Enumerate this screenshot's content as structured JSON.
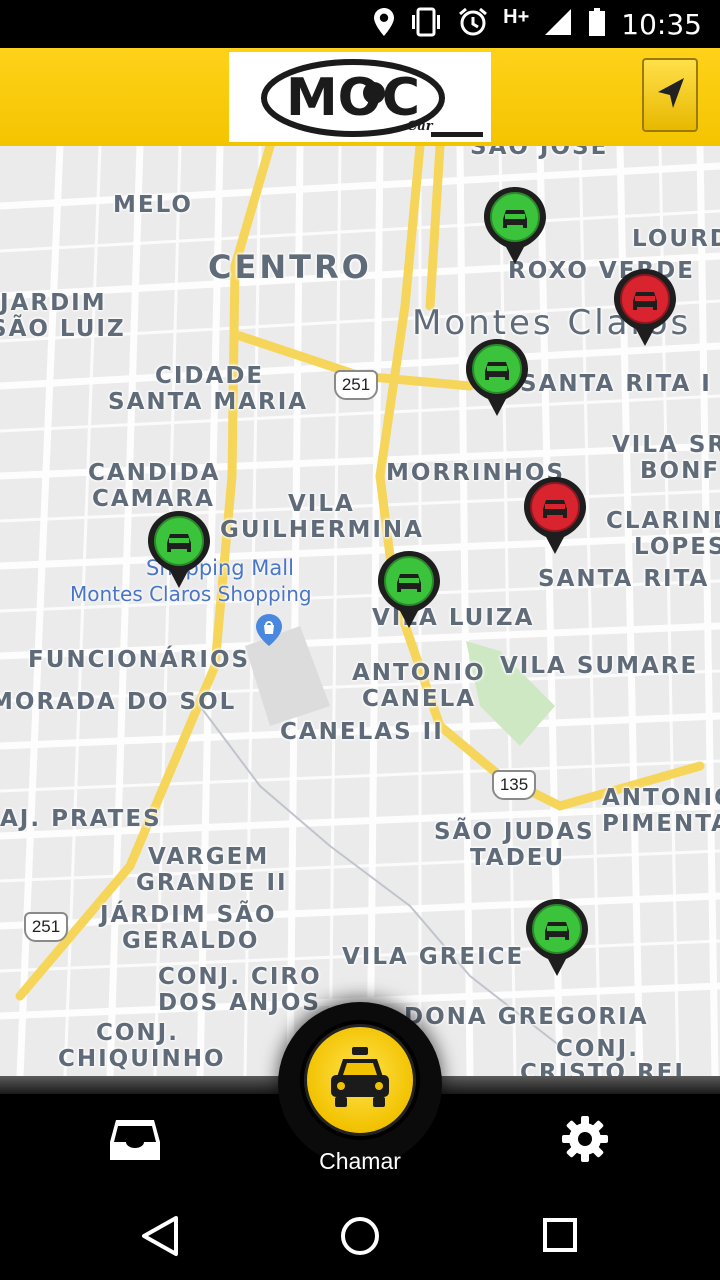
{
  "status_bar": {
    "time": "10:35",
    "network": "H+"
  },
  "app": {
    "logo_text": "MOC",
    "logo_sub": "Car"
  },
  "map": {
    "labels": [
      {
        "text": "SÃO JOSÉ"
      },
      {
        "text": "MELO"
      },
      {
        "text": "CENTRO"
      },
      {
        "text": "LOURD"
      },
      {
        "text": "ROXO VERDE"
      },
      {
        "text": "JARDIM"
      },
      {
        "text": "SÃO LUIZ"
      },
      {
        "text": "Montes Claros"
      },
      {
        "text": "CIDADE"
      },
      {
        "text": "SANTA MARIA"
      },
      {
        "text": "SANTA RITA I"
      },
      {
        "text": "VILA SR"
      },
      {
        "text": "BONF"
      },
      {
        "text": "CANDIDA"
      },
      {
        "text": "CAMARA"
      },
      {
        "text": "MORRINHOS"
      },
      {
        "text": "VILA"
      },
      {
        "text": "GUILHERMINA"
      },
      {
        "text": "CLARIND"
      },
      {
        "text": "LOPES"
      },
      {
        "text": "SANTA RITA"
      },
      {
        "text": "VILA LUIZA"
      },
      {
        "text": "FUNCIONÁRIOS"
      },
      {
        "text": "ANTONIO"
      },
      {
        "text": "CANELA"
      },
      {
        "text": "VILA SUMARE"
      },
      {
        "text": "MORADA DO SOL"
      },
      {
        "text": "CANELAS II"
      },
      {
        "text": "ANTONIO"
      },
      {
        "text": "PIMENTA"
      },
      {
        "text": "AJ. PRATES"
      },
      {
        "text": "SÃO JUDAS"
      },
      {
        "text": "TADEU"
      },
      {
        "text": "VARGEM"
      },
      {
        "text": "GRANDE II"
      },
      {
        "text": "JÁRDIM SÃO"
      },
      {
        "text": "GERALDO"
      },
      {
        "text": "VILA GREICE"
      },
      {
        "text": "CONJ. CIRO"
      },
      {
        "text": "DOS ANJOS"
      },
      {
        "text": "DONA GREGORIA"
      },
      {
        "text": "CONJ."
      },
      {
        "text": "CHIQUINHO"
      },
      {
        "text": "CONJ."
      },
      {
        "text": "CRISTO REI"
      }
    ],
    "poi": [
      {
        "text": "Shopping Mall"
      },
      {
        "text": "Montes Claros Shopping"
      }
    ],
    "road_shields": [
      {
        "text": "251"
      },
      {
        "text": "135"
      },
      {
        "text": "251"
      }
    ],
    "markers": [
      {
        "status": "available",
        "color": "#3cc33c"
      },
      {
        "status": "busy",
        "color": "#d9242f"
      },
      {
        "status": "available",
        "color": "#3cc33c"
      },
      {
        "status": "busy",
        "color": "#d9242f"
      },
      {
        "status": "available",
        "color": "#3cc33c"
      },
      {
        "status": "available",
        "color": "#3cc33c"
      },
      {
        "status": "available",
        "color": "#3cc33c"
      }
    ]
  },
  "bottom": {
    "call_label": "Chamar"
  },
  "colors": {
    "brand_yellow": "#f4c400",
    "available": "#3cc33c",
    "busy": "#d9242f"
  }
}
